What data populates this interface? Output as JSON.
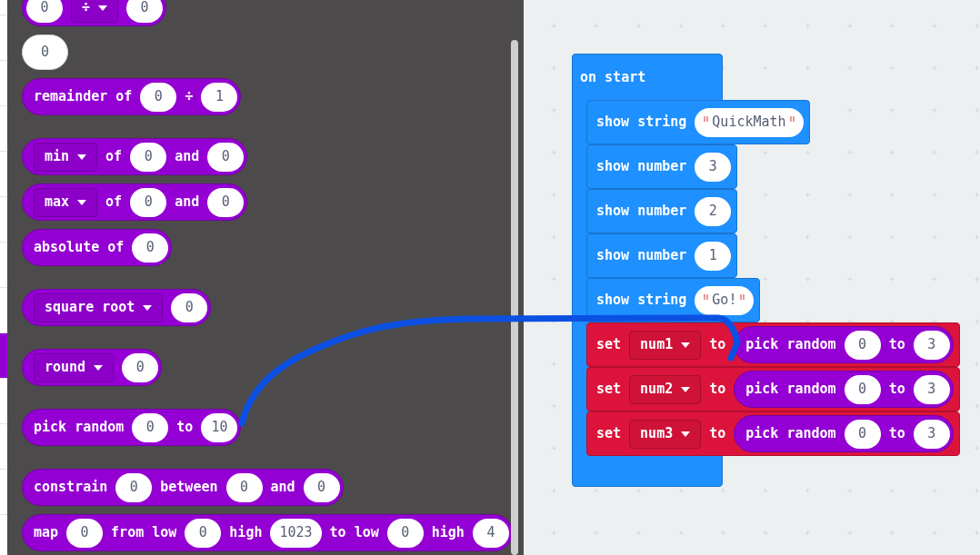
{
  "categories": [
    {
      "selected": false
    },
    {
      "selected": false
    },
    {
      "selected": false
    },
    {
      "selected": false
    },
    {
      "selected": false
    },
    {
      "selected": false
    },
    {
      "selected": false
    },
    {
      "selected": false
    },
    {
      "selected": true
    },
    {
      "selected": false
    },
    {
      "selected": false
    },
    {
      "selected": false
    }
  ],
  "flyout": {
    "sections": [
      {
        "blocks": [
          {
            "kind": "reporter",
            "parts": [
              {
                "kind": "number",
                "value": "0"
              },
              {
                "kind": "dropdown",
                "text": "÷"
              },
              {
                "kind": "number",
                "value": "0"
              }
            ]
          },
          {
            "kind": "number",
            "value": "0"
          },
          {
            "kind": "reporter",
            "parts": [
              {
                "kind": "label",
                "text": "remainder of"
              },
              {
                "kind": "number",
                "value": "0"
              },
              {
                "kind": "label",
                "text": "÷"
              },
              {
                "kind": "number",
                "value": "1"
              }
            ]
          }
        ]
      },
      {
        "blocks": [
          {
            "kind": "reporter",
            "parts": [
              {
                "kind": "dropdown",
                "text": "min"
              },
              {
                "kind": "label",
                "text": "of"
              },
              {
                "kind": "number",
                "value": "0"
              },
              {
                "kind": "label",
                "text": "and"
              },
              {
                "kind": "number",
                "value": "0"
              }
            ]
          },
          {
            "kind": "reporter",
            "parts": [
              {
                "kind": "dropdown",
                "text": "max"
              },
              {
                "kind": "label",
                "text": "of"
              },
              {
                "kind": "number",
                "value": "0"
              },
              {
                "kind": "label",
                "text": "and"
              },
              {
                "kind": "number",
                "value": "0"
              }
            ]
          },
          {
            "kind": "reporter",
            "parts": [
              {
                "kind": "label",
                "text": "absolute of"
              },
              {
                "kind": "number",
                "value": "0"
              }
            ]
          }
        ]
      },
      {
        "blocks": [
          {
            "kind": "reporter",
            "parts": [
              {
                "kind": "dropdown",
                "text": "square root"
              },
              {
                "kind": "number",
                "value": "0"
              }
            ]
          }
        ]
      },
      {
        "blocks": [
          {
            "kind": "reporter",
            "parts": [
              {
                "kind": "dropdown",
                "text": "round"
              },
              {
                "kind": "number",
                "value": "0"
              }
            ]
          }
        ]
      },
      {
        "blocks": [
          {
            "kind": "reporter",
            "parts": [
              {
                "kind": "label",
                "text": "pick random"
              },
              {
                "kind": "number",
                "value": "0"
              },
              {
                "kind": "label",
                "text": "to"
              },
              {
                "kind": "number",
                "value": "10"
              }
            ]
          }
        ]
      },
      {
        "blocks": [
          {
            "kind": "reporter",
            "parts": [
              {
                "kind": "label",
                "text": "constrain"
              },
              {
                "kind": "number",
                "value": "0"
              },
              {
                "kind": "label",
                "text": "between"
              },
              {
                "kind": "number",
                "value": "0"
              },
              {
                "kind": "label",
                "text": "and"
              },
              {
                "kind": "number",
                "value": "0"
              }
            ]
          },
          {
            "kind": "reporter",
            "parts": [
              {
                "kind": "label",
                "text": "map"
              },
              {
                "kind": "number",
                "value": "0"
              },
              {
                "kind": "label",
                "text": "from low"
              },
              {
                "kind": "number",
                "value": "0"
              },
              {
                "kind": "label",
                "text": "high"
              },
              {
                "kind": "number",
                "value": "1023"
              },
              {
                "kind": "label",
                "text": "to low"
              },
              {
                "kind": "number",
                "value": "0"
              },
              {
                "kind": "label",
                "text": "high"
              },
              {
                "kind": "number",
                "value": "4"
              }
            ]
          }
        ]
      }
    ]
  },
  "workspace": {
    "event_block": {
      "label": "on start",
      "statements": [
        {
          "kind": "basic",
          "parts": [
            {
              "kind": "label",
              "text": "show string"
            },
            {
              "kind": "string",
              "value": "QuickMath"
            }
          ]
        },
        {
          "kind": "basic",
          "parts": [
            {
              "kind": "label",
              "text": "show number"
            },
            {
              "kind": "number",
              "value": "3"
            }
          ]
        },
        {
          "kind": "basic",
          "parts": [
            {
              "kind": "label",
              "text": "show number"
            },
            {
              "kind": "number",
              "value": "2"
            }
          ]
        },
        {
          "kind": "basic",
          "parts": [
            {
              "kind": "label",
              "text": "show number"
            },
            {
              "kind": "number",
              "value": "1"
            }
          ]
        },
        {
          "kind": "basic",
          "parts": [
            {
              "kind": "label",
              "text": "show string"
            },
            {
              "kind": "string",
              "value": "Go!"
            }
          ]
        },
        {
          "kind": "variables",
          "parts": [
            {
              "kind": "label",
              "text": "set"
            },
            {
              "kind": "dropdown",
              "text": "num1"
            },
            {
              "kind": "label",
              "text": "to"
            },
            {
              "kind": "block",
              "parts": [
                {
                  "kind": "label",
                  "text": "pick random"
                },
                {
                  "kind": "number",
                  "value": "0"
                },
                {
                  "kind": "label",
                  "text": "to"
                },
                {
                  "kind": "number",
                  "value": "3"
                }
              ]
            }
          ]
        },
        {
          "kind": "variables",
          "parts": [
            {
              "kind": "label",
              "text": "set"
            },
            {
              "kind": "dropdown",
              "text": "num2"
            },
            {
              "kind": "label",
              "text": "to"
            },
            {
              "kind": "block",
              "parts": [
                {
                  "kind": "label",
                  "text": "pick random"
                },
                {
                  "kind": "number",
                  "value": "0"
                },
                {
                  "kind": "label",
                  "text": "to"
                },
                {
                  "kind": "number",
                  "value": "3"
                }
              ]
            }
          ]
        },
        {
          "kind": "variables",
          "parts": [
            {
              "kind": "label",
              "text": "set"
            },
            {
              "kind": "dropdown",
              "text": "num3"
            },
            {
              "kind": "label",
              "text": "to"
            },
            {
              "kind": "block",
              "parts": [
                {
                  "kind": "label",
                  "text": "pick random"
                },
                {
                  "kind": "number",
                  "value": "0"
                },
                {
                  "kind": "label",
                  "text": "to"
                },
                {
                  "kind": "number",
                  "value": "3"
                }
              ]
            }
          ]
        }
      ]
    }
  }
}
